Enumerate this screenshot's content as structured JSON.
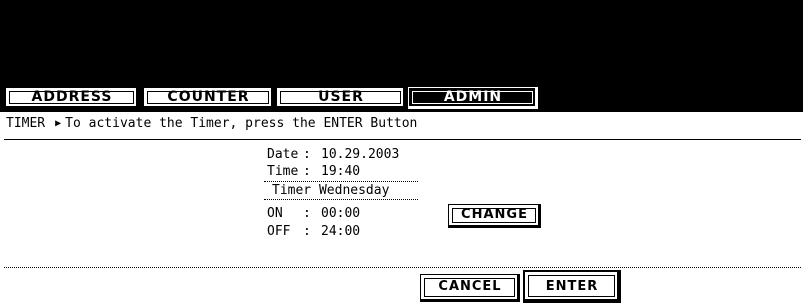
{
  "tabs": [
    {
      "label": "ADDRESS",
      "active": false
    },
    {
      "label": "COUNTER",
      "active": false
    },
    {
      "label": "USER",
      "active": false
    },
    {
      "label": "ADMIN",
      "active": true
    }
  ],
  "header": {
    "section": "TIMER",
    "arrow_icon": "right-triangle-icon",
    "instruction": "To activate the Timer, press the ENTER Button"
  },
  "datetime": {
    "date_label": "Date",
    "date_value": "10.29.2003",
    "time_label": "Time",
    "time_value": "19:40"
  },
  "timer": {
    "title": "Timer Wednesday",
    "on_label": "ON",
    "on_value": "00:00",
    "off_label": "OFF",
    "off_value": "24:00",
    "change_label": "CHANGE"
  },
  "footer": {
    "cancel_label": "CANCEL",
    "enter_label": "ENTER"
  },
  "colors": {
    "background": "#ffffff",
    "foreground": "#000000"
  }
}
